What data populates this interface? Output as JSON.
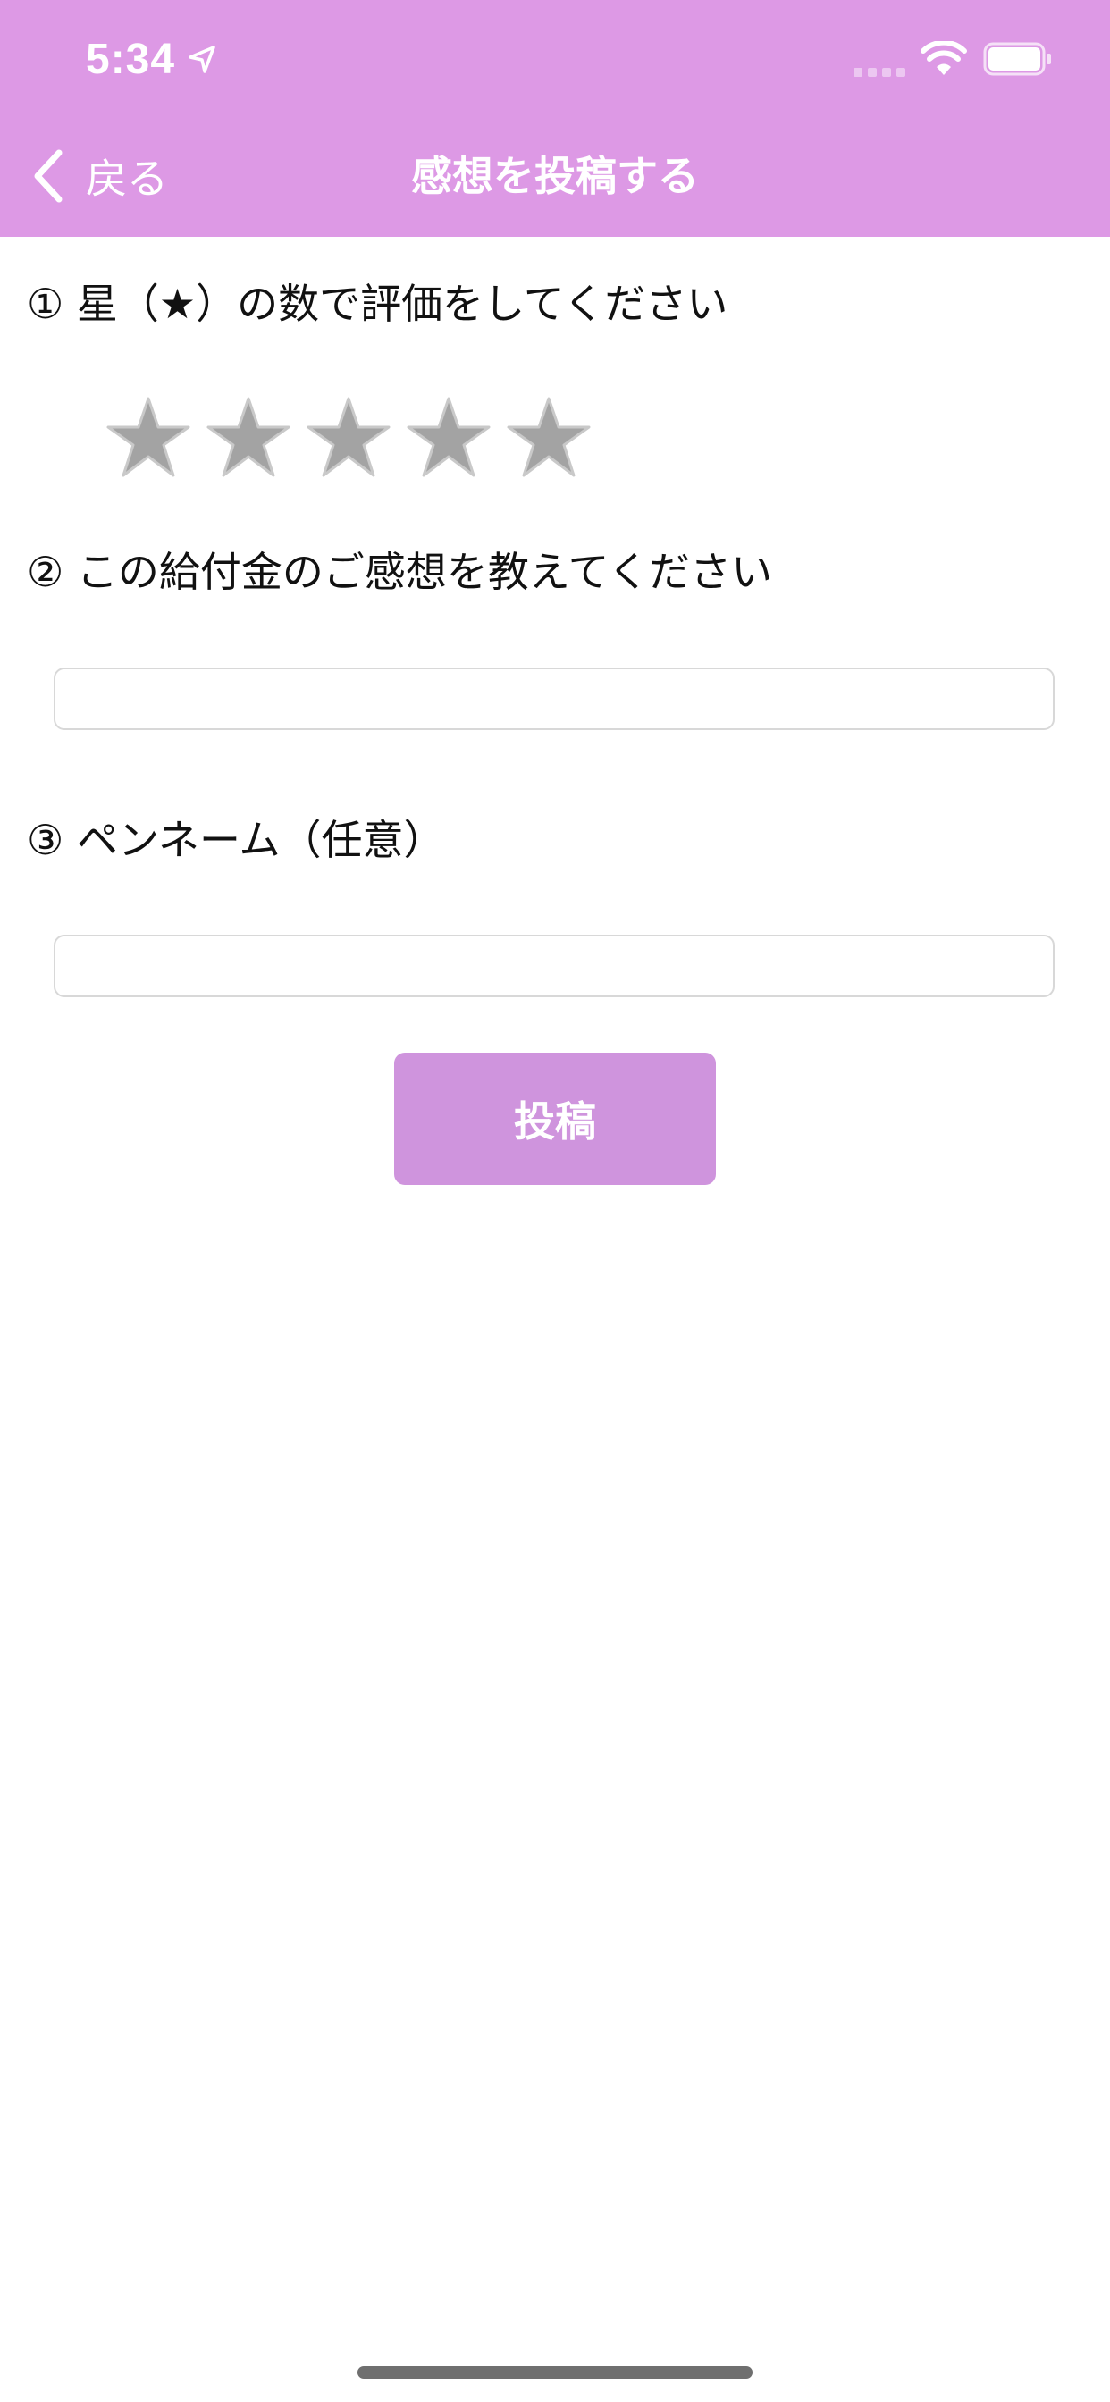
{
  "status_bar": {
    "time": "5:34"
  },
  "nav": {
    "back_label": "戻る",
    "title": "感想を投稿する"
  },
  "form": {
    "q1_label": "① 星（★）の数で評価をしてください",
    "rating": {
      "value": 0,
      "max": 5
    },
    "q2_label": "② この給付金のご感想を教えてください",
    "comment_value": "",
    "comment_placeholder": "",
    "q3_label": "③ ペンネーム（任意）",
    "penname_value": "",
    "penname_placeholder": "",
    "submit_label": "投稿"
  },
  "colors": {
    "header_bg": "#dd99e5",
    "button_bg": "#cf94dd",
    "star_empty": "#a3a3a3",
    "star_border": "#c9c9c9"
  },
  "icons": {
    "location": "location-arrow-icon",
    "signal": "cellular-signal-icon",
    "wifi": "wifi-icon",
    "battery": "battery-icon",
    "back": "chevron-left-icon",
    "star": "star-icon"
  }
}
